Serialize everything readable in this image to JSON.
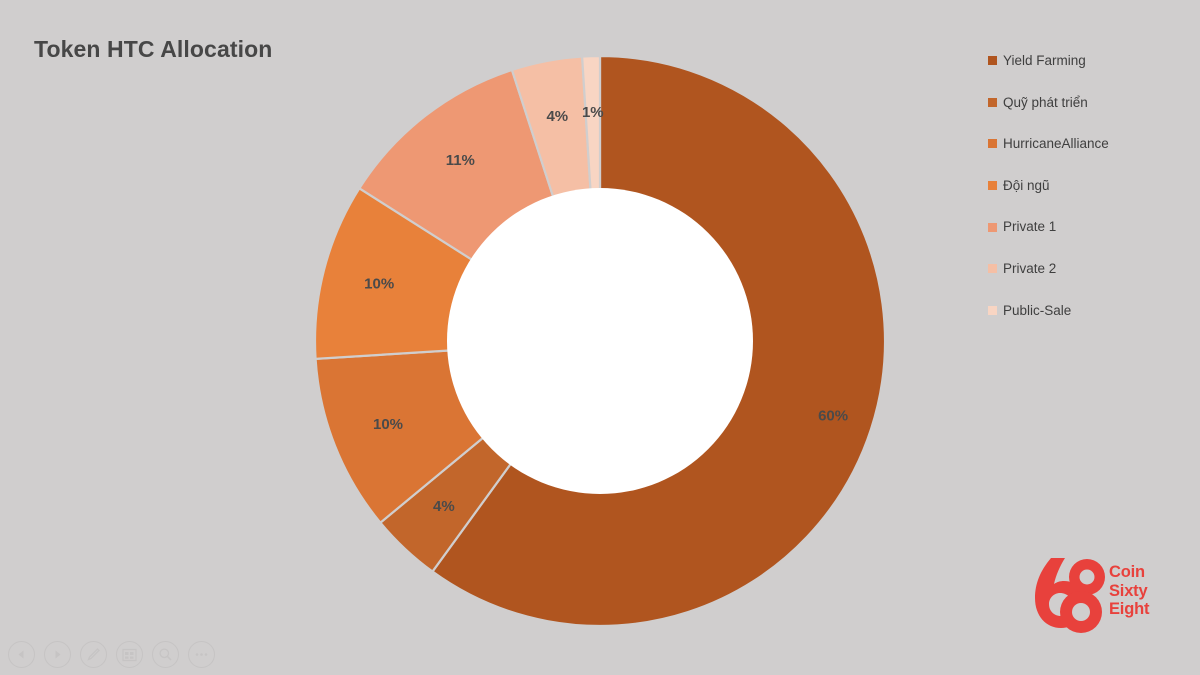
{
  "slide": {
    "title": "Token HTC Allocation",
    "background_color": "#d0cece"
  },
  "chart_data": {
    "type": "pie",
    "variant": "donut",
    "title": "Token HTC Allocation",
    "xlabel": "",
    "ylabel": "",
    "start_angle_deg": 0,
    "direction": "clockwise",
    "inner_radius_ratio": 0.537,
    "legend_position": "right",
    "grid": false,
    "categories": [
      "Yield Farming",
      "Quỹ phát triển",
      "HurricaneAlliance",
      "Đội ngũ",
      "Private 1",
      "Private 2",
      "Public-Sale"
    ],
    "values": [
      60,
      4,
      10,
      10,
      11,
      4,
      1
    ],
    "value_labels": [
      "60%",
      "4%",
      "10%",
      "10%",
      "11%",
      "4%",
      "1%"
    ],
    "colors": [
      "#b0551f",
      "#c2662b",
      "#da7534",
      "#e8813a",
      "#ee9873",
      "#f5bfa5",
      "#f8d5c3"
    ],
    "slice_separator_color": "#d0cece"
  },
  "legend": {
    "items": [
      {
        "label": "Yield Farming",
        "color": "#b0551f"
      },
      {
        "label": "Quỹ phát triển",
        "color": "#c2662b"
      },
      {
        "label": "HurricaneAlliance",
        "color": "#da7534"
      },
      {
        "label": "Đội ngũ",
        "color": "#e8813a"
      },
      {
        "label": "Private 1",
        "color": "#ee9873"
      },
      {
        "label": "Private 2",
        "color": "#f5bfa5"
      },
      {
        "label": "Public-Sale",
        "color": "#f8d5c3"
      }
    ]
  },
  "logo": {
    "mark": "68",
    "line1": "Coin",
    "line2": "Sixty",
    "line3": "Eight",
    "color": "#e8413c"
  },
  "toolbar": {
    "buttons": [
      {
        "name": "previous-slide-button",
        "icon": "triangle-left-icon"
      },
      {
        "name": "next-slide-button",
        "icon": "triangle-right-icon"
      },
      {
        "name": "pen-tool-button",
        "icon": "pen-icon"
      },
      {
        "name": "slide-overview-button",
        "icon": "grid-icon"
      },
      {
        "name": "zoom-tool-button",
        "icon": "magnifier-icon"
      },
      {
        "name": "more-options-button",
        "icon": "ellipsis-icon"
      }
    ]
  }
}
